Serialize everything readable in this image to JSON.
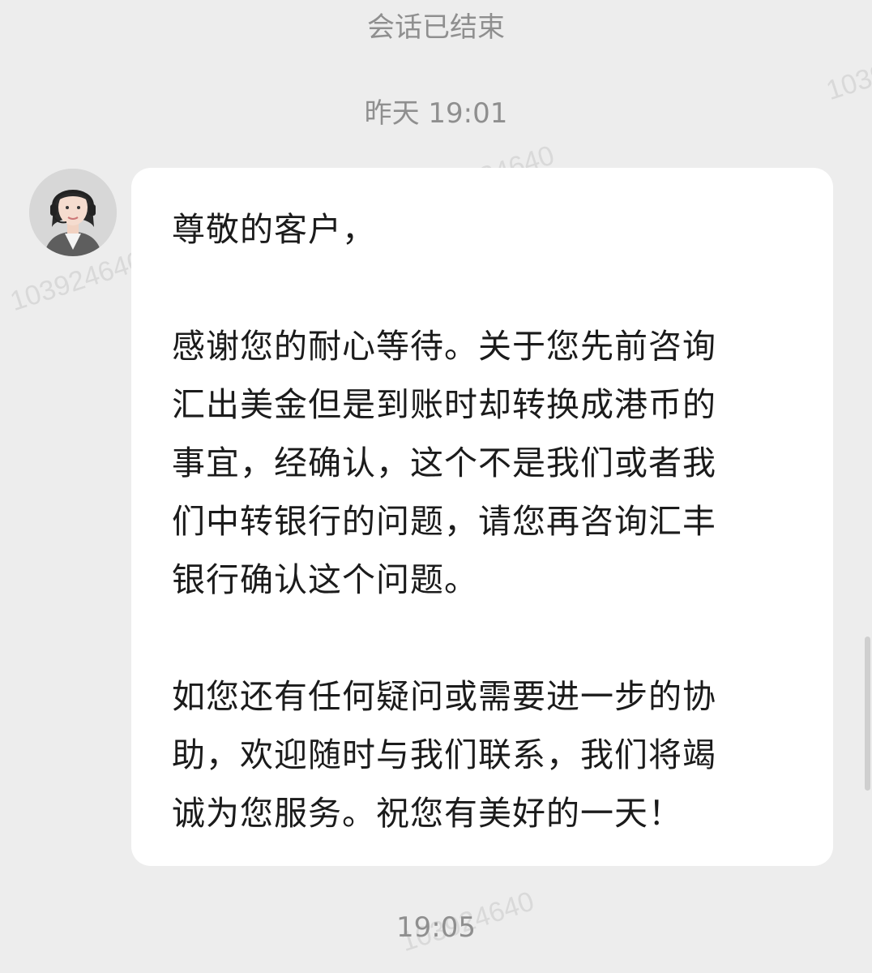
{
  "system_note": "会话已结束",
  "timestamps": {
    "top": "昨天 19:01",
    "bottom": "19:05"
  },
  "message": {
    "sender_avatar": "agent-avatar",
    "lines": [
      "尊敬的客户，",
      "",
      "感谢您的耐心等待。关于您先前咨询",
      "汇出美金但是到账时却转换成港币的",
      "事宜，经确认，这个不是我们或者我",
      "们中转银行的问题，请您再咨询汇丰",
      "银行确认这个问题。",
      "",
      "如您还有任何疑问或需要进一步的协",
      "助，欢迎随时与我们联系，我们将竭",
      "诚为您服务。祝您有美好的一天！"
    ]
  },
  "watermark": "103924640"
}
